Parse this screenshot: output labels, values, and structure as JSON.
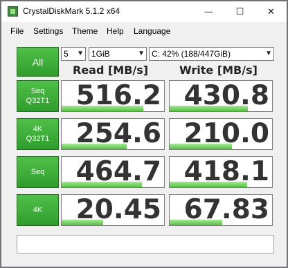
{
  "window": {
    "title": "CrystalDiskMark 5.1.2 x64",
    "controls": {
      "minimize": "—",
      "maximize": "☐",
      "close": "✕"
    }
  },
  "menu": [
    "File",
    "Settings",
    "Theme",
    "Help",
    "Language"
  ],
  "toolbar": {
    "all_label": "All",
    "count": "5",
    "size": "1GiB",
    "drive": "C: 42% (188/447GiB)"
  },
  "columns": {
    "read": "Read [MB/s]",
    "write": "Write [MB/s]"
  },
  "rows": [
    {
      "label1": "Seq",
      "label2": "Q32T1",
      "read": "516.2",
      "write": "430.8"
    },
    {
      "label1": "4K",
      "label2": "Q32T1",
      "read": "254.6",
      "write": "210.0"
    },
    {
      "label1": "Seq",
      "label2": "",
      "read": "464.7",
      "write": "418.1"
    },
    {
      "label1": "4K",
      "label2": "",
      "read": "20.45",
      "write": "67.83"
    }
  ],
  "status": "",
  "colors": {
    "button_green": "#2f9d2b",
    "bar_green": "#54c23f"
  }
}
